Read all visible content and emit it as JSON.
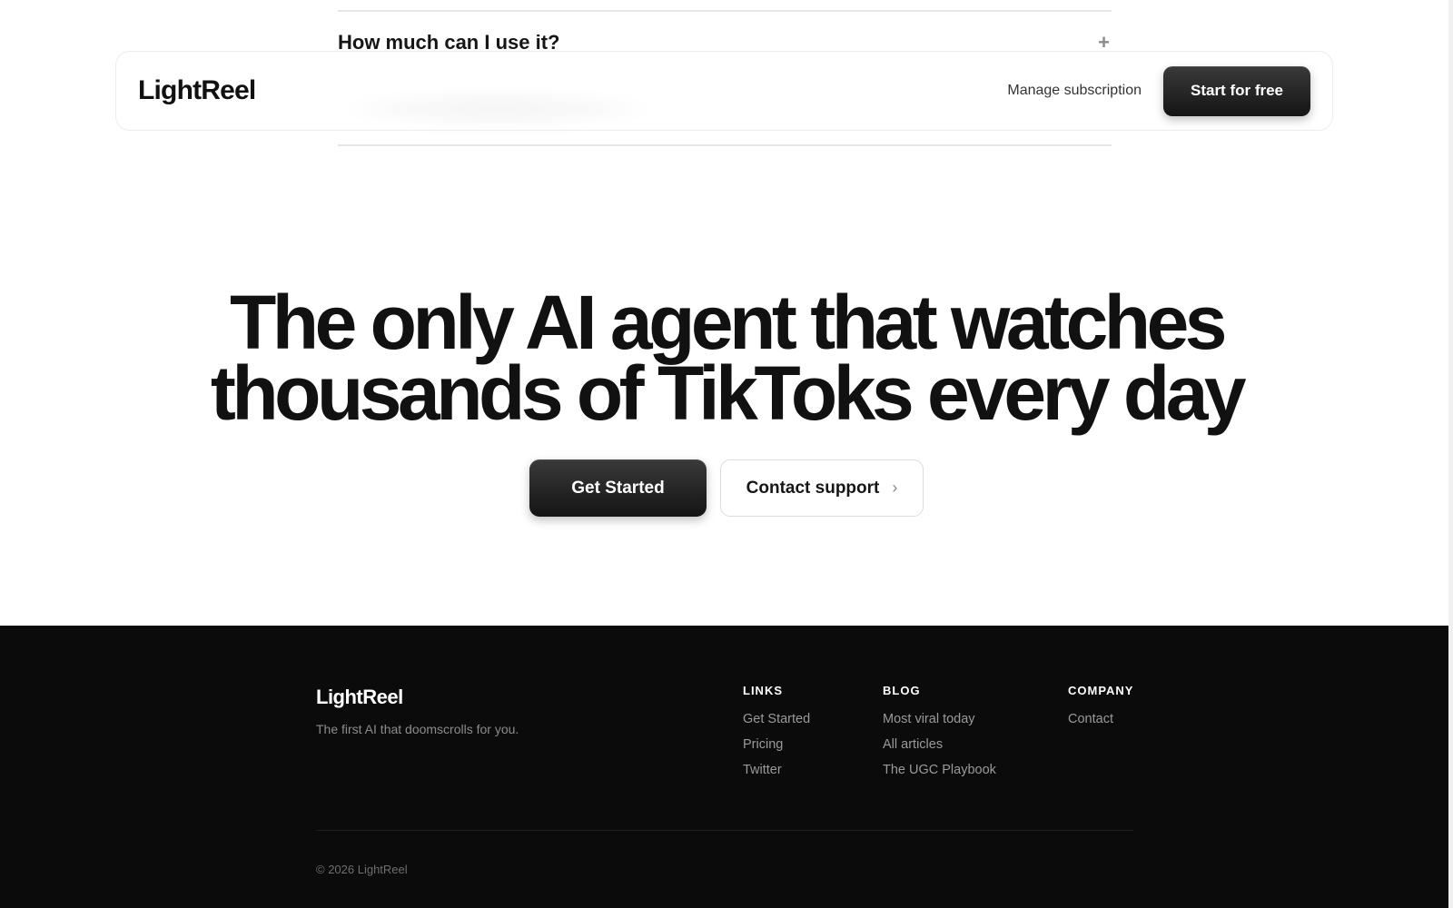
{
  "faq": {
    "question": "How much can I use it?",
    "toggle_symbol": "+"
  },
  "navbar": {
    "logo": "LightReel",
    "manage_link": "Manage subscription",
    "cta_label": "Start for free"
  },
  "hero": {
    "title_line_1": "The only AI agent that watches",
    "title_line_2": "thousands of TikToks every day",
    "primary_label": "Get Started",
    "secondary_label": "Contact support",
    "secondary_icon": "›"
  },
  "footer": {
    "logo": "LightReel",
    "tagline": "The first AI that doomscrolls for you.",
    "columns": [
      {
        "heading": "LINKS",
        "items": [
          "Get Started",
          "Pricing",
          "Twitter"
        ]
      },
      {
        "heading": "BLOG",
        "items": [
          "Most viral today",
          "All articles",
          "The UGC Playbook"
        ]
      },
      {
        "heading": "COMPANY",
        "items": [
          "Contact"
        ]
      }
    ],
    "copyright": "© 2026 LightReel"
  },
  "colors": {
    "background": "#ffffff",
    "text": "#111111",
    "footer_bg": "#0b0b0b",
    "button_dark": "#1a1a1a"
  }
}
